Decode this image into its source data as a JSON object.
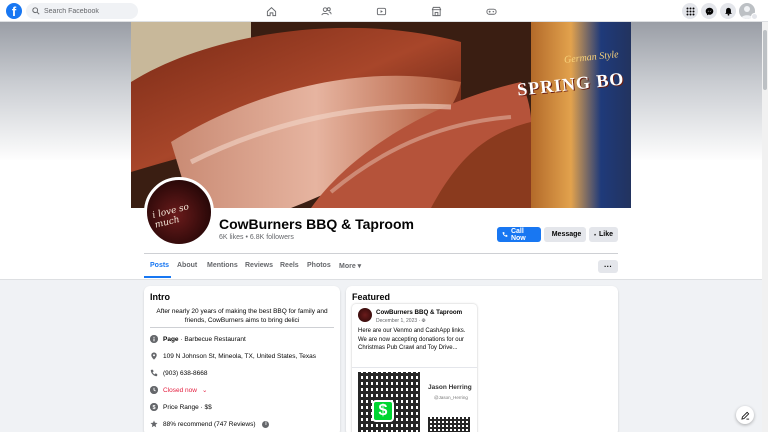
{
  "topnav": {
    "logo": "f",
    "search_placeholder": "Search Facebook",
    "tabs": [
      "home-icon",
      "friends-icon",
      "watch-icon",
      "marketplace-icon",
      "gaming-icon"
    ],
    "right_icons": [
      "menu-grid-icon",
      "messenger-icon",
      "notifications-icon",
      "account-icon"
    ]
  },
  "cover": {
    "can_text": "SPRING BO",
    "can_subtext": "German Style"
  },
  "profile": {
    "pic_text": "i love so much",
    "name": "CowBurners BBQ & Taproom",
    "stats": "6K likes • 6.8K followers"
  },
  "actions": {
    "call": "Call Now",
    "message": "Message",
    "like": "Like"
  },
  "tabs": [
    "Posts",
    "About",
    "Mentions",
    "Reviews",
    "Reels",
    "Photos",
    "More ▾"
  ],
  "tabs_more_button": "···",
  "intro": {
    "title": "Intro",
    "description": "After nearly 20 years of making the best BBQ for family and friends, CowBurners aims to bring delici",
    "page_label": "Page",
    "page_category": " · Barbecue Restaurant",
    "address": "109 N Johnson St, Mineola, TX, United States, Texas",
    "phone": "(903) 638-8668",
    "hours": "Closed now",
    "hours_caret": "⌄",
    "price_range": "Price Range · $$",
    "recommend": "88% recommend (747 Reviews)",
    "info": "i"
  },
  "featured": {
    "title": "Featured",
    "post": {
      "author": "CowBurners BBQ & Taproom",
      "date": "December 1, 2023 ·",
      "text": "Here are our Venmo and CashApp links. We are now accepting donations for our Christmas Pub Crawl and Toy Drive...",
      "cashapp_symbol": "$",
      "venmo_name": "Jason Herring",
      "venmo_handle": "@Jason_Herring"
    }
  },
  "colors": {
    "brand_blue": "#1877f2",
    "closed_red": "#e41e3f",
    "cashapp_green": "#00d632"
  }
}
